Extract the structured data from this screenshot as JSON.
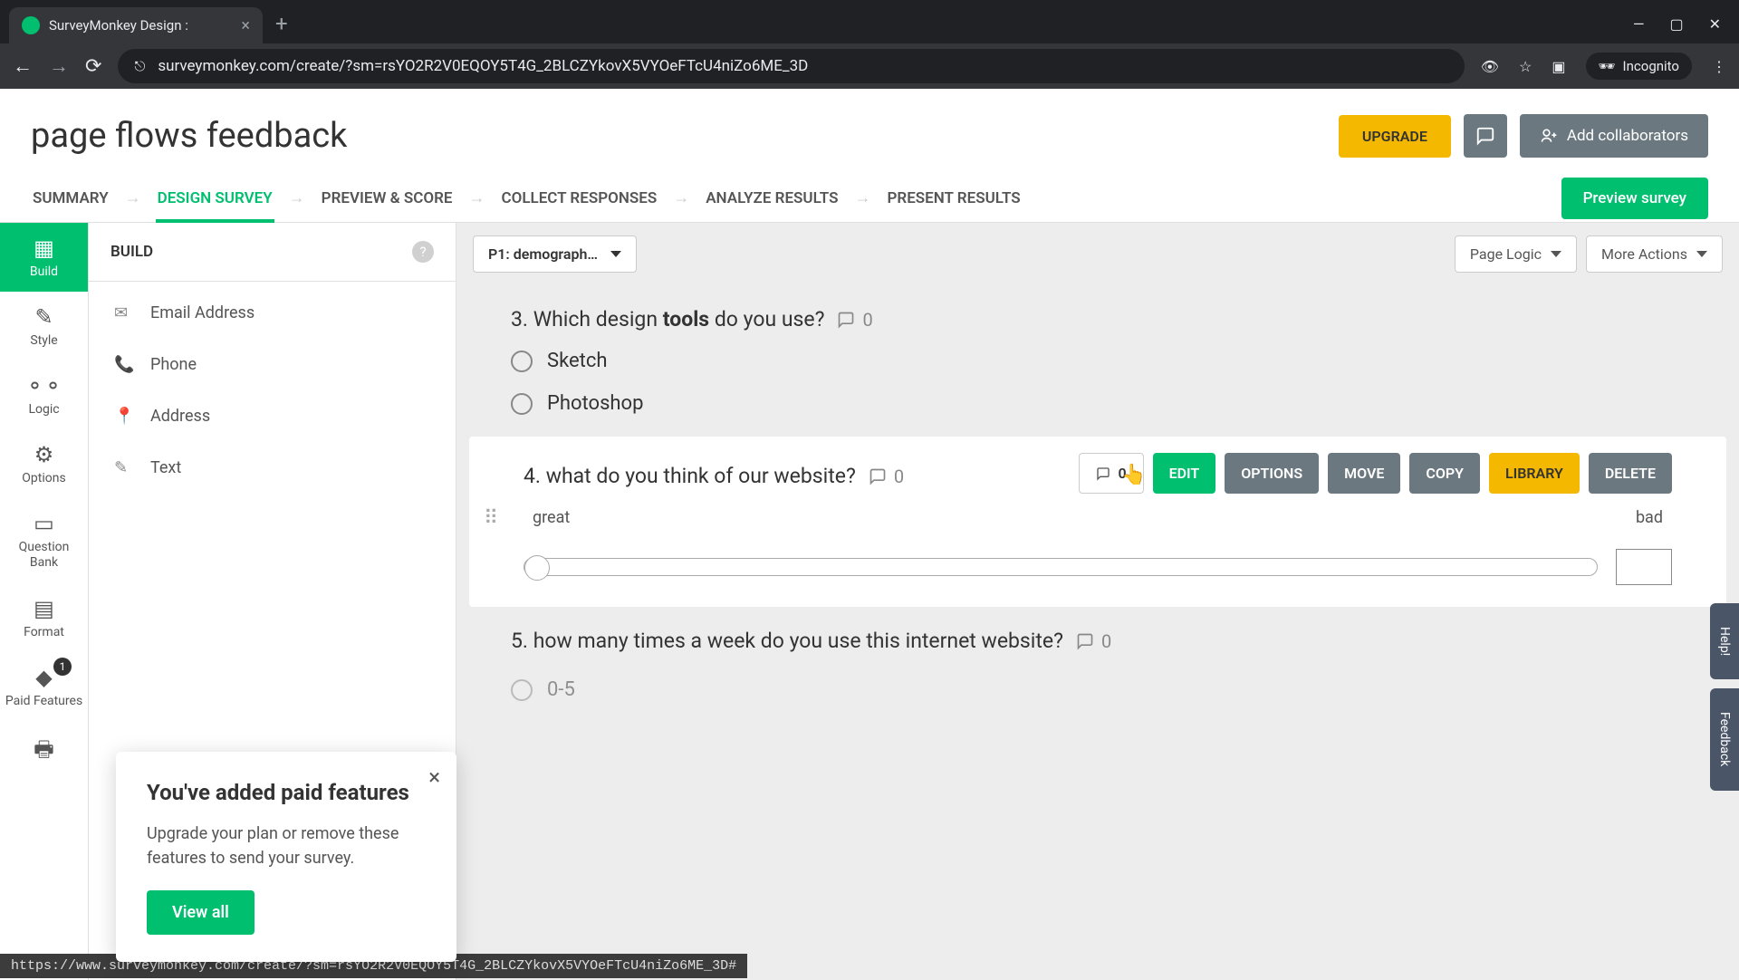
{
  "browser": {
    "tab_title": "SurveyMonkey Design :",
    "url": "surveymonkey.com/create/?sm=rsYO2R2V0EQOY5T4G_2BLCZYkovX5VYOeFTcU4niZo6ME_3D",
    "incognito": "Incognito",
    "status_url": "https://www.surveymonkey.com/create/?sm=rsYO2R2V0EQOY5T4G_2BLCZYkovX5VYOeFTcU4niZo6ME_3D#"
  },
  "header": {
    "title": "page flows feedback",
    "upgrade": "UPGRADE",
    "collab": "Add collaborators"
  },
  "tabs": {
    "items": [
      "SUMMARY",
      "DESIGN SURVEY",
      "PREVIEW & SCORE",
      "COLLECT RESPONSES",
      "ANALYZE RESULTS",
      "PRESENT RESULTS"
    ],
    "preview": "Preview survey"
  },
  "rail": {
    "items": [
      "Build",
      "Style",
      "Logic",
      "Options",
      "Question Bank",
      "Format",
      "Paid Features"
    ],
    "badge": "1"
  },
  "sidebar": {
    "title": "BUILD",
    "items": [
      {
        "icon": "✉",
        "label": "Email Address"
      },
      {
        "icon": "📞",
        "label": "Phone"
      },
      {
        "icon": "📍",
        "label": "Address"
      },
      {
        "icon": "✎",
        "label": "Text"
      }
    ]
  },
  "popup": {
    "title": "You've added paid features",
    "body": "Upgrade your plan or remove these features to send your survey.",
    "cta": "View all"
  },
  "canvas": {
    "page_select": "P1: demograph…",
    "page_logic": "Page Logic",
    "more_actions": "More Actions"
  },
  "questions": {
    "q3": {
      "num": "3.",
      "pre": "Which design ",
      "bold": "tools",
      "post": " do you use?",
      "comments": "0",
      "opts": [
        "Sketch",
        "Photoshop"
      ]
    },
    "q4": {
      "num": "4.",
      "text": "what do you think of our website?",
      "comments": "0",
      "actions": {
        "comment": "0",
        "edit": "EDIT",
        "options": "OPTIONS",
        "move": "MOVE",
        "copy": "COPY",
        "library": "LIBRARY",
        "delete": "DELETE"
      },
      "left": "great",
      "right": "bad"
    },
    "q5": {
      "num": "5.",
      "text": "how many times a week do you use this internet website?",
      "comments": "0",
      "opt1": "0-5"
    }
  },
  "side": {
    "help": "Help!",
    "feedback": "Feedback"
  }
}
